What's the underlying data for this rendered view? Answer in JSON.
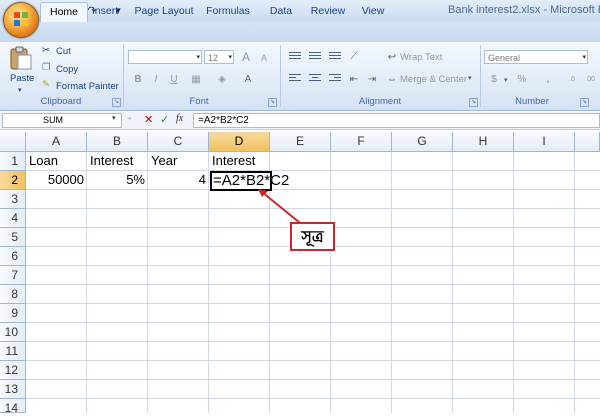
{
  "window": {
    "title": "Bank interest2.xlsx - Microsoft E"
  },
  "qat": {
    "save": "💾",
    "undo": "↶",
    "redo": "↷",
    "customize": "▾"
  },
  "tabs": [
    "Home",
    "Insert",
    "Page Layout",
    "Formulas",
    "Data",
    "Review",
    "View"
  ],
  "active_tab": "Home",
  "ribbon": {
    "clipboard": {
      "paste": "Paste",
      "cut": "Cut",
      "copy": "Copy",
      "format_painter": "Format Painter",
      "label": "Clipboard"
    },
    "font": {
      "font_name": "",
      "font_size": "12",
      "grow": "A",
      "shrink": "A",
      "bold": "B",
      "italic": "I",
      "underline": "U",
      "font_color": "A",
      "label": "Font"
    },
    "alignment": {
      "wrap_text": "Wrap Text",
      "merge_center": "Merge & Center",
      "label": "Alignment"
    },
    "number": {
      "format": "General",
      "currency": "$",
      "percent": "%",
      "comma": ",",
      "label": "Number"
    }
  },
  "formula_bar": {
    "name_box": "SUM",
    "cancel": "✕",
    "enter": "✓",
    "fx": "fx",
    "formula": "=A2*B2*C2"
  },
  "sheet": {
    "columns": [
      "A",
      "B",
      "C",
      "D",
      "E",
      "F",
      "G",
      "H",
      "I"
    ],
    "rows": [
      "1",
      "2",
      "3",
      "4",
      "5",
      "6",
      "7",
      "8",
      "9",
      "10",
      "11",
      "12",
      "13",
      "14"
    ],
    "cells": {
      "A1": "Loan",
      "B1": "Interest",
      "C1": "Year",
      "D1": "Interest",
      "A2": "50000",
      "B2": "5%",
      "C2": "4",
      "D2": "=A2*B2*C2"
    },
    "active_cell": "D2"
  },
  "annotation": {
    "text": "সূত্র",
    "color": "#c8282d"
  },
  "colors": {
    "accent": "#15428b",
    "selection": "#f1c15f",
    "annotation": "#c8282d"
  }
}
